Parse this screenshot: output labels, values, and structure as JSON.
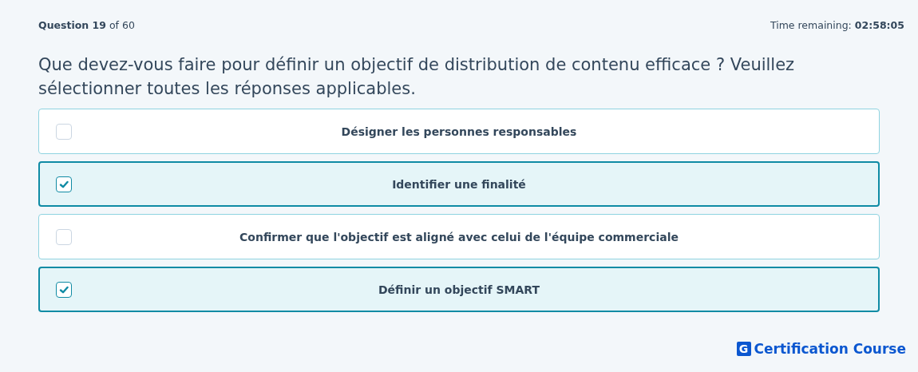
{
  "header": {
    "progress": "**Question 19** of 60",
    "timer": "Time remaining: **02:58:05**"
  },
  "question": "Que devez-vous faire pour définir un objectif de distribution de contenu efficace ? Veuillez sélectionner toutes les réponses applicables.",
  "options": [
    {
      "label": "Désigner les personnes responsables",
      "checked": false
    },
    {
      "label": "Identifier une finalité",
      "checked": true
    },
    {
      "label": "Confirmer que l'objectif est aligné avec celui de l'équipe commerciale",
      "checked": false
    },
    {
      "label": "Définir un objectif SMART",
      "checked": true
    }
  ],
  "brand": {
    "logo_letter": "G",
    "name": "Certification Course"
  }
}
